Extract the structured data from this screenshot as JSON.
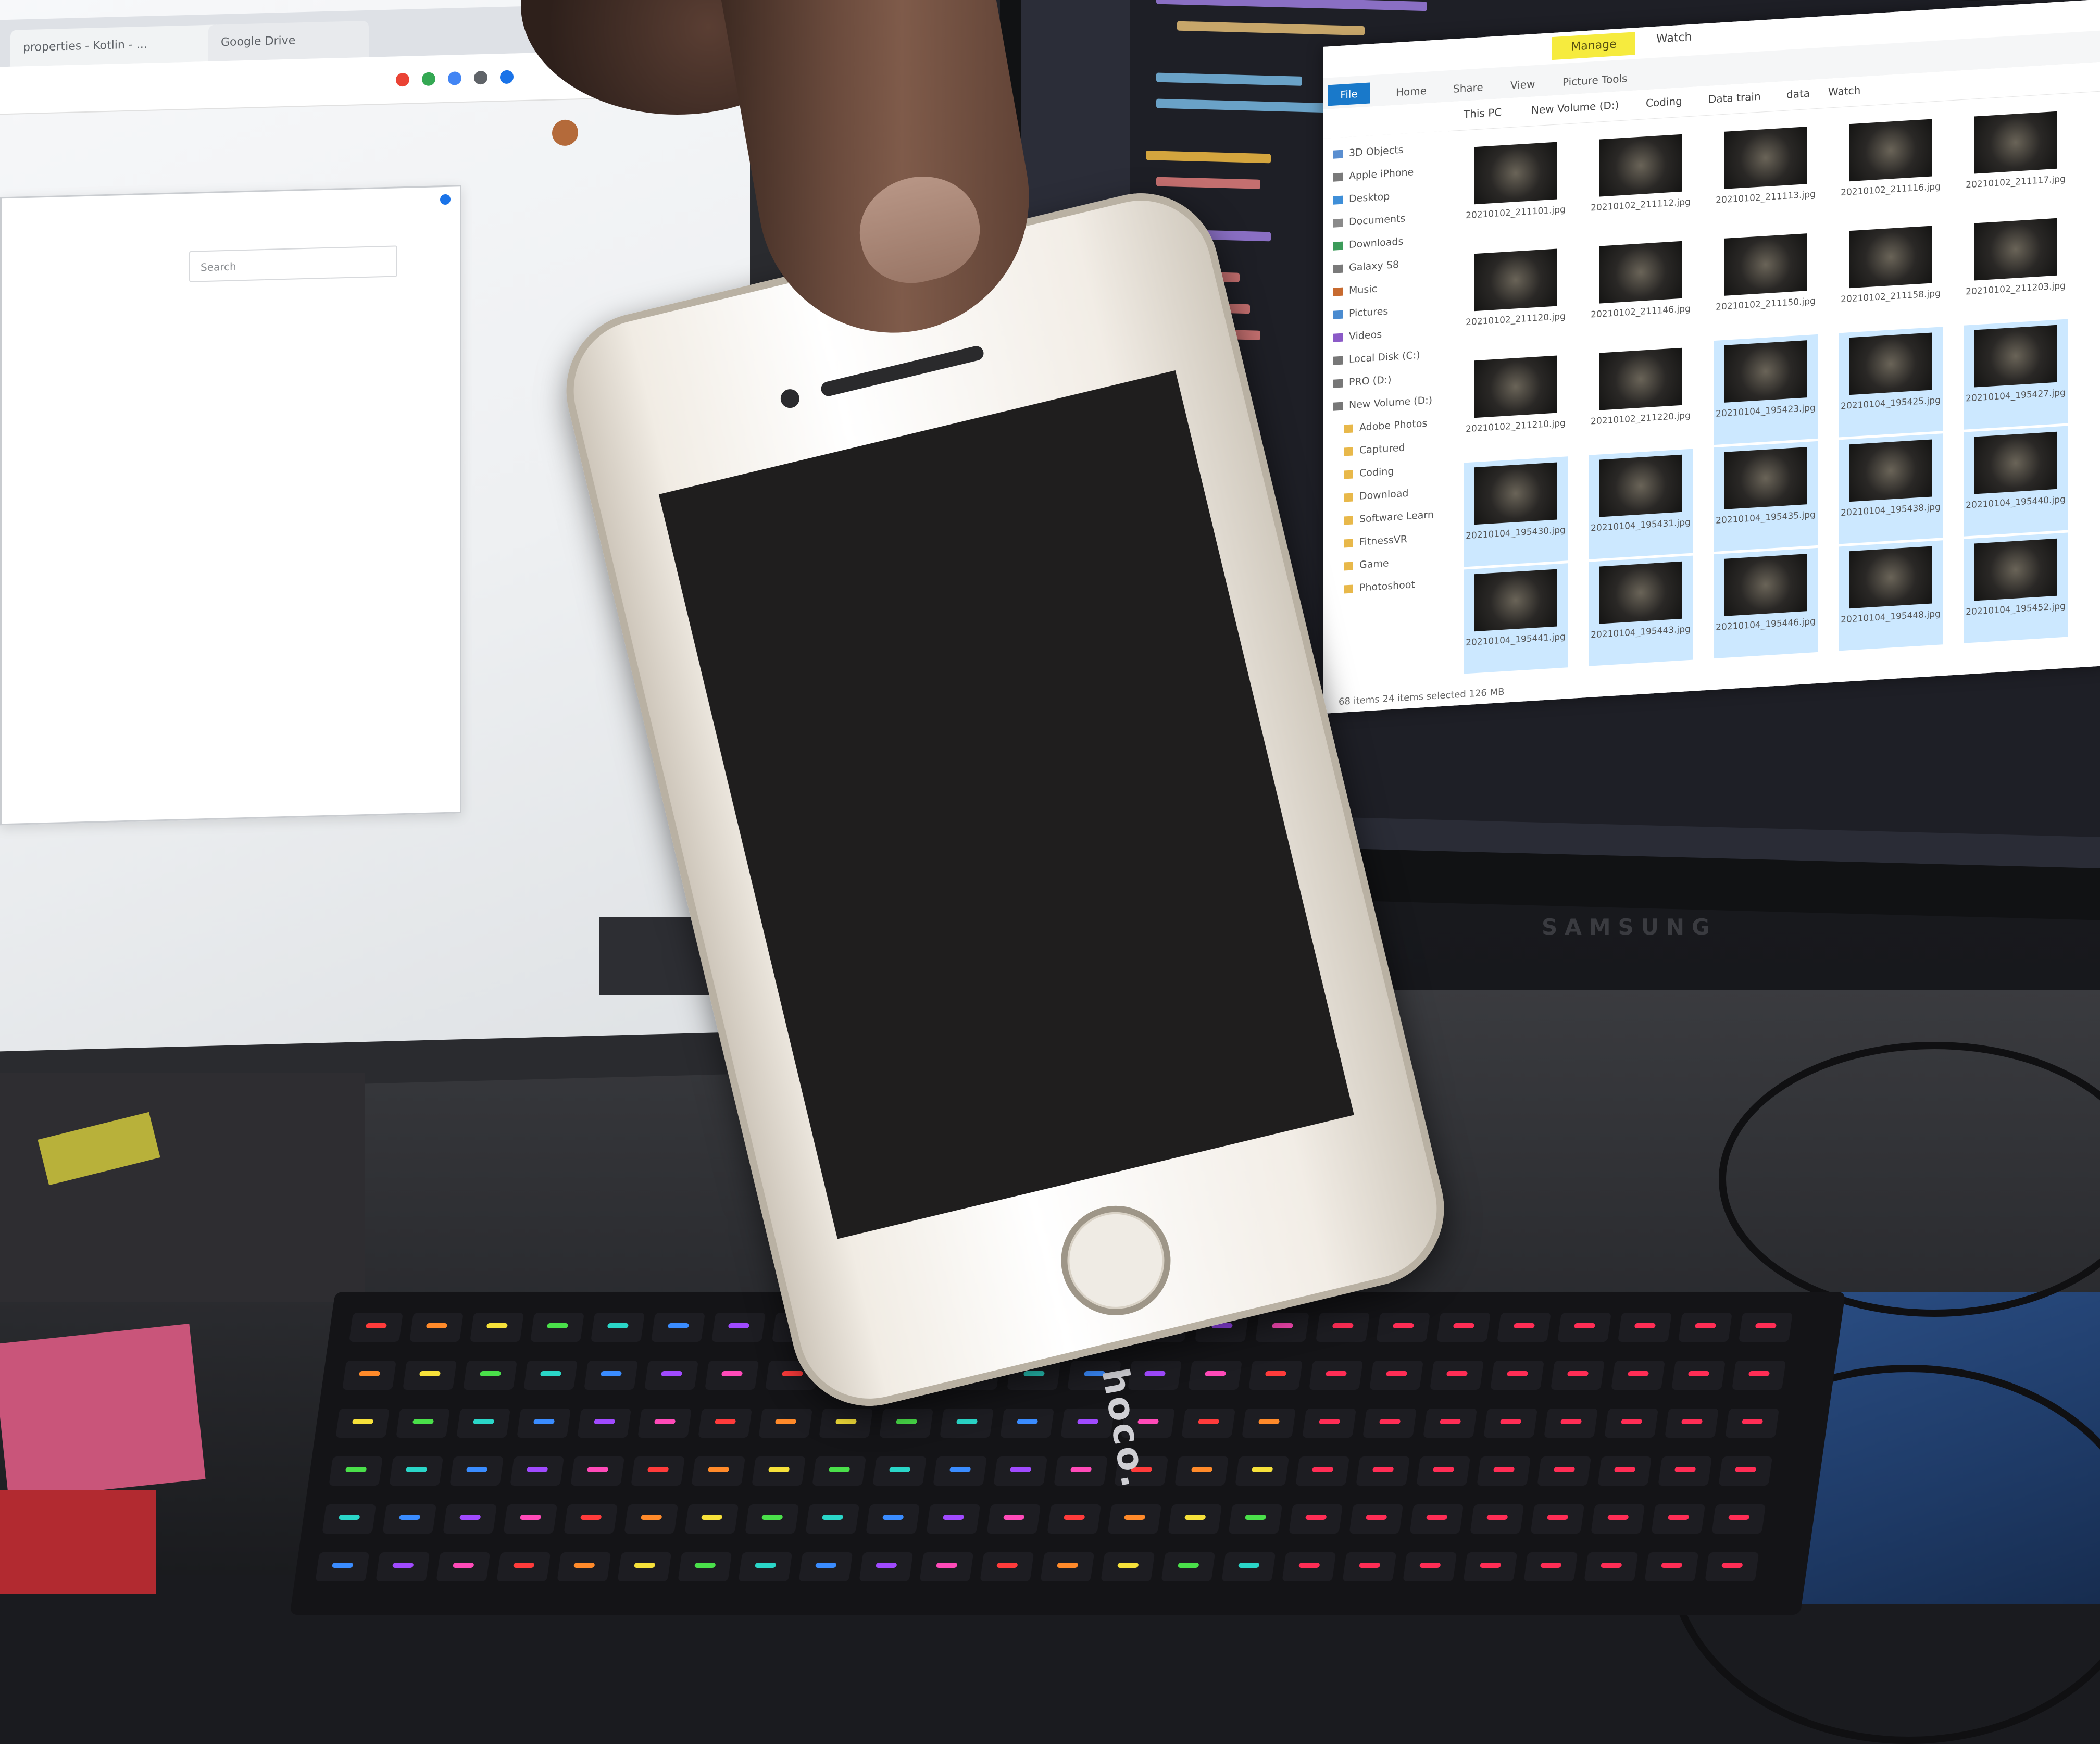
{
  "scene": {
    "left_monitor": {
      "browser_tabs": [
        "properties - Kotlin - ...",
        "Google Drive"
      ],
      "dialog_search_placeholder": "Search "
    },
    "right_monitor": {
      "brand": "SAMSUNG",
      "explorer": {
        "manage_label": "Manage",
        "window_title": "Watch",
        "file_tab": "File",
        "ribbon_tabs": [
          "Home",
          "Share",
          "View",
          "Picture Tools"
        ],
        "breadcrumb": [
          "This PC",
          "New Volume (D:)",
          "Coding",
          "Data train",
          "data",
          "Watch"
        ],
        "nav_items": [
          "3D Objects",
          "Apple iPhone",
          "Desktop",
          "Documents",
          "Downloads",
          "Galaxy S8",
          "Music",
          "Pictures",
          "Videos",
          "Local Disk (C:)",
          "PRO (D:)",
          "New Volume (D:)",
          "Adobe Photos",
          "Captured",
          "Coding",
          "Download",
          "Software Learn",
          "FitnessVR",
          "Game",
          "Photoshoot"
        ],
        "thumbnails": [
          {
            "label": "20210102_211101.jpg",
            "selected": false
          },
          {
            "label": "20210102_211112.jpg",
            "selected": false
          },
          {
            "label": "20210102_211113.jpg",
            "selected": false
          },
          {
            "label": "20210102_211116.jpg",
            "selected": false
          },
          {
            "label": "20210102_211117.jpg",
            "selected": false
          },
          {
            "label": "20210102_211120.jpg",
            "selected": false
          },
          {
            "label": "20210102_211146.jpg",
            "selected": false
          },
          {
            "label": "20210102_211150.jpg",
            "selected": false
          },
          {
            "label": "20210102_211158.jpg",
            "selected": false
          },
          {
            "label": "20210102_211203.jpg",
            "selected": false
          },
          {
            "label": "20210102_211210.jpg",
            "selected": false
          },
          {
            "label": "20210102_211220.jpg",
            "selected": false
          },
          {
            "label": "20210104_195423.jpg",
            "selected": true
          },
          {
            "label": "20210104_195425.jpg",
            "selected": true
          },
          {
            "label": "20210104_195427.jpg",
            "selected": true
          },
          {
            "label": "20210104_195430.jpg",
            "selected": true
          },
          {
            "label": "20210104_195431.jpg",
            "selected": true
          },
          {
            "label": "20210104_195435.jpg",
            "selected": true
          },
          {
            "label": "20210104_195438.jpg",
            "selected": true
          },
          {
            "label": "20210104_195440.jpg",
            "selected": true
          },
          {
            "label": "20210104_195441.jpg",
            "selected": true
          },
          {
            "label": "20210104_195443.jpg",
            "selected": true
          },
          {
            "label": "20210104_195446.jpg",
            "selected": true
          },
          {
            "label": "20210104_195448.jpg",
            "selected": true
          },
          {
            "label": "20210104_195452.jpg",
            "selected": true
          }
        ],
        "status": "68 items   24 items selected  126 MB"
      }
    },
    "keyboard_brand": "hoco.",
    "phone": {
      "screen_state": "off"
    },
    "colors": {
      "explorer_accent": "#1979ca",
      "manage_highlight": "#f6eb3e",
      "selection": "#cce8ff"
    }
  }
}
